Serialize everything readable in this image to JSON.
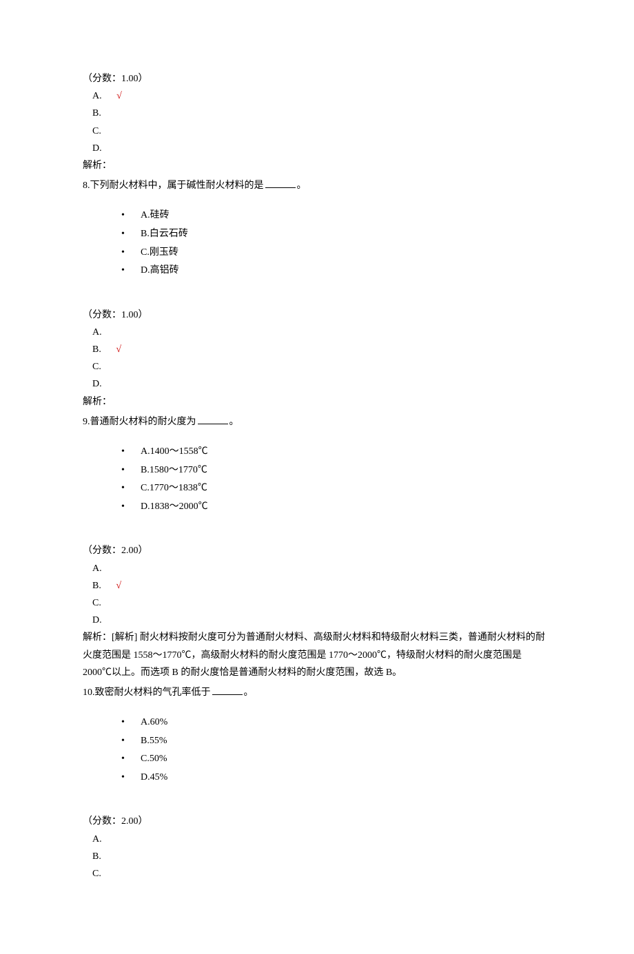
{
  "q7": {
    "score_line": "（分数：1.00）",
    "answers": {
      "a": "A.",
      "b": "B.",
      "c": "C.",
      "d": "D."
    },
    "correct": "a",
    "analysis_label": "解析："
  },
  "q8": {
    "question": "8.下列耐火材料中，属于碱性耐火材料的是",
    "period": "。",
    "options": {
      "a": "A.硅砖",
      "b": "B.白云石砖",
      "c": "C.刚玉砖",
      "d": "D.高铝砖"
    },
    "score_line": "（分数：1.00）",
    "answers": {
      "a": "A.",
      "b": "B.",
      "c": "C.",
      "d": "D."
    },
    "correct": "b",
    "analysis_label": "解析："
  },
  "q9": {
    "question": "9.普通耐火材料的耐火度为",
    "period": "。",
    "options": {
      "a": "A.1400～1558℃",
      "b": "B.1580～1770℃",
      "c": "C.1770～1838℃",
      "d": "D.1838～2000℃"
    },
    "score_line": "（分数：2.00）",
    "answers": {
      "a": "A.",
      "b": "B.",
      "c": "C.",
      "d": "D."
    },
    "correct": "b",
    "analysis_text": "解析：[解析] 耐火材料按耐火度可分为普通耐火材料、高级耐火材料和特级耐火材料三类，普通耐火材料的耐火度范围是 1558～1770℃，高级耐火材料的耐火度范围是 1770～2000℃，特级耐火材料的耐火度范围是 2000℃以上。而选项 B 的耐火度恰是普通耐火材料的耐火度范围，故选 B。"
  },
  "q10": {
    "question": "10.致密耐火材料的气孔率低于",
    "period": "。",
    "options": {
      "a": "A.60%",
      "b": "B.55%",
      "c": "C.50%",
      "d": "D.45%"
    },
    "score_line": "（分数：2.00）",
    "answers": {
      "a": "A.",
      "b": "B.",
      "c": "C."
    }
  },
  "checkmark": "√"
}
